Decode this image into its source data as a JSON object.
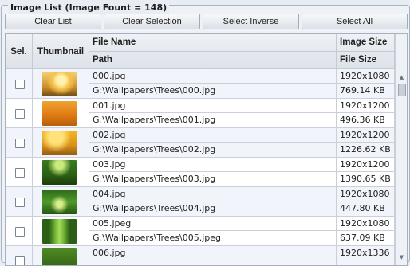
{
  "group_title": "Image List (Image Fount = 148)",
  "buttons": {
    "clear_list": "Clear List",
    "clear_selection": "Clear Selection",
    "select_inverse": "Select Inverse",
    "select_all": "Select All"
  },
  "columns": {
    "sel": "Sel.",
    "thumbnail": "Thumbnail",
    "file_name": "File Name",
    "path": "Path",
    "image_size": "Image Size",
    "file_size": "File Size"
  },
  "rows": [
    {
      "name": "000.jpg",
      "path": "G:\\Wallpapers\\Trees\\000.jpg",
      "image_size": "1920x1080",
      "file_size": "769.14 KB",
      "thumb": "autumn-tree-sunrise"
    },
    {
      "name": "001.jpg",
      "path": "G:\\Wallpapers\\Trees\\001.jpg",
      "image_size": "1920x1200",
      "file_size": "496.36 KB",
      "thumb": "orange-autumn-trees"
    },
    {
      "name": "002.jpg",
      "path": "G:\\Wallpapers\\Trees\\002.jpg",
      "image_size": "1920x1200",
      "file_size": "1226.62 KB",
      "thumb": "yellow-autumn-road"
    },
    {
      "name": "003.jpg",
      "path": "G:\\Wallpapers\\Trees\\003.jpg",
      "image_size": "1920x1200",
      "file_size": "1390.65 KB",
      "thumb": "green-forest-path"
    },
    {
      "name": "004.jpg",
      "path": "G:\\Wallpapers\\Trees\\004.jpg",
      "image_size": "1920x1080",
      "file_size": "447.80 KB",
      "thumb": "green-tree-tunnel"
    },
    {
      "name": "005.jpeg",
      "path": "G:\\Wallpapers\\Trees\\005.jpeg",
      "image_size": "1920x1080",
      "file_size": "637.09 KB",
      "thumb": "green-lane-trees"
    },
    {
      "name": "006.jpg",
      "path": "",
      "image_size": "1920x1336",
      "file_size": "",
      "thumb": "green-forest"
    }
  ],
  "colors": {
    "row_even": "#ffffff",
    "row_odd": "#f1f4fa",
    "cell_border": "#c9d0d9",
    "header_bg": "#dde2e9"
  }
}
